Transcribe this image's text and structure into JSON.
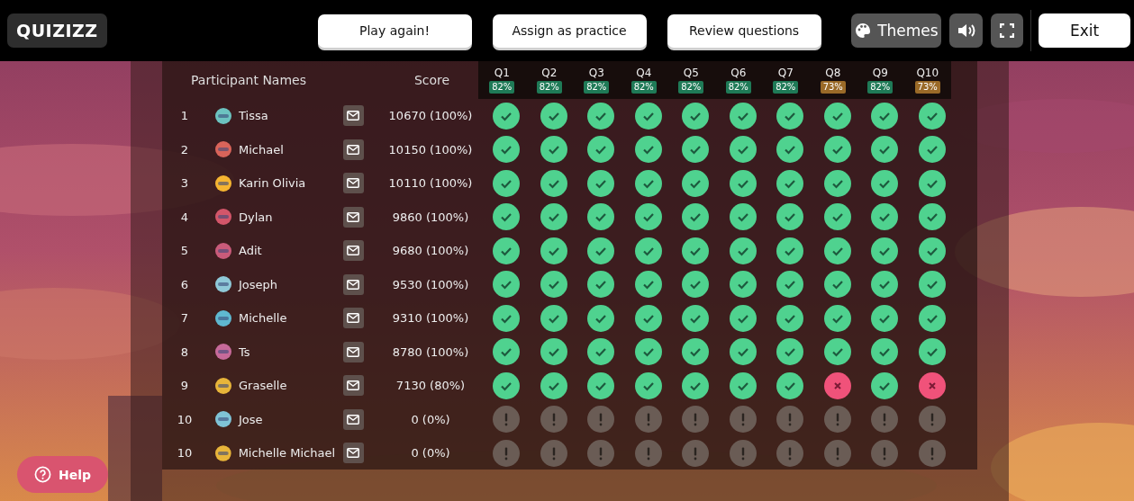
{
  "logo": "QUIZIZZ",
  "toolbar": {
    "buttons": [
      "Play again!",
      "Assign as practice",
      "Review questions"
    ],
    "themes": "Themes",
    "exit": "Exit"
  },
  "table": {
    "name_heading": "Participant Names",
    "score_heading": "Score",
    "questions": [
      {
        "label": "Q1",
        "accuracy": "82%",
        "color": "#1f7a57"
      },
      {
        "label": "Q2",
        "accuracy": "82%",
        "color": "#1f7a57"
      },
      {
        "label": "Q3",
        "accuracy": "82%",
        "color": "#1f7a57"
      },
      {
        "label": "Q4",
        "accuracy": "82%",
        "color": "#1f7a57"
      },
      {
        "label": "Q5",
        "accuracy": "82%",
        "color": "#1f7a57"
      },
      {
        "label": "Q6",
        "accuracy": "82%",
        "color": "#1f7a57"
      },
      {
        "label": "Q7",
        "accuracy": "82%",
        "color": "#1f7a57"
      },
      {
        "label": "Q8",
        "accuracy": "73%",
        "color": "#9a6a28"
      },
      {
        "label": "Q9",
        "accuracy": "82%",
        "color": "#1f7a57"
      },
      {
        "label": "Q10",
        "accuracy": "73%",
        "color": "#9a6a28"
      }
    ],
    "rows": [
      {
        "rank": "1",
        "name": "Tissa",
        "color": "#6cc3c0",
        "score": "10670 (100%)",
        "answers": [
          {
            "kind": "correct"
          },
          {
            "kind": "correct"
          },
          {
            "kind": "correct"
          },
          {
            "kind": "correct"
          },
          {
            "kind": "correct"
          },
          {
            "kind": "correct"
          },
          {
            "kind": "correct"
          },
          {
            "kind": "correct"
          },
          {
            "kind": "correct"
          },
          {
            "kind": "correct"
          }
        ]
      },
      {
        "rank": "2",
        "name": "Michael",
        "color": "#d9645a",
        "score": "10150 (100%)",
        "answers": [
          {
            "kind": "correct"
          },
          {
            "kind": "correct"
          },
          {
            "kind": "correct"
          },
          {
            "kind": "correct"
          },
          {
            "kind": "correct"
          },
          {
            "kind": "correct"
          },
          {
            "kind": "correct"
          },
          {
            "kind": "correct"
          },
          {
            "kind": "correct"
          },
          {
            "kind": "correct"
          }
        ]
      },
      {
        "rank": "3",
        "name": "Karin Olivia",
        "color": "#f5b531",
        "score": "10110 (100%)",
        "answers": [
          {
            "kind": "correct"
          },
          {
            "kind": "correct"
          },
          {
            "kind": "correct"
          },
          {
            "kind": "correct"
          },
          {
            "kind": "correct"
          },
          {
            "kind": "correct"
          },
          {
            "kind": "correct"
          },
          {
            "kind": "correct"
          },
          {
            "kind": "correct"
          },
          {
            "kind": "correct"
          }
        ]
      },
      {
        "rank": "4",
        "name": "Dylan",
        "color": "#d4566a",
        "score": "9860 (100%)",
        "answers": [
          {
            "kind": "correct"
          },
          {
            "kind": "correct"
          },
          {
            "kind": "correct"
          },
          {
            "kind": "correct"
          },
          {
            "kind": "correct"
          },
          {
            "kind": "correct"
          },
          {
            "kind": "correct"
          },
          {
            "kind": "correct"
          },
          {
            "kind": "correct"
          },
          {
            "kind": "correct"
          }
        ]
      },
      {
        "rank": "5",
        "name": "Adit",
        "color": "#c95b7a",
        "score": "9680 (100%)",
        "answers": [
          {
            "kind": "correct"
          },
          {
            "kind": "correct"
          },
          {
            "kind": "correct"
          },
          {
            "kind": "correct"
          },
          {
            "kind": "correct"
          },
          {
            "kind": "correct"
          },
          {
            "kind": "correct"
          },
          {
            "kind": "correct"
          },
          {
            "kind": "correct"
          },
          {
            "kind": "correct"
          }
        ]
      },
      {
        "rank": "6",
        "name": "Joseph",
        "color": "#8fc9d8",
        "score": "9530 (100%)",
        "answers": [
          {
            "kind": "correct"
          },
          {
            "kind": "correct"
          },
          {
            "kind": "correct"
          },
          {
            "kind": "correct"
          },
          {
            "kind": "correct"
          },
          {
            "kind": "correct"
          },
          {
            "kind": "correct"
          },
          {
            "kind": "correct"
          },
          {
            "kind": "correct"
          },
          {
            "kind": "correct"
          }
        ]
      },
      {
        "rank": "7",
        "name": "Michelle",
        "color": "#5fb8d0",
        "score": "9310 (100%)",
        "answers": [
          {
            "kind": "correct"
          },
          {
            "kind": "correct"
          },
          {
            "kind": "correct"
          },
          {
            "kind": "correct"
          },
          {
            "kind": "correct"
          },
          {
            "kind": "correct"
          },
          {
            "kind": "correct"
          },
          {
            "kind": "correct"
          },
          {
            "kind": "correct"
          },
          {
            "kind": "correct"
          }
        ]
      },
      {
        "rank": "8",
        "name": "Ts",
        "color": "#c76a9a",
        "score": "8780 (100%)",
        "answers": [
          {
            "kind": "correct"
          },
          {
            "kind": "correct"
          },
          {
            "kind": "correct"
          },
          {
            "kind": "correct"
          },
          {
            "kind": "correct"
          },
          {
            "kind": "correct"
          },
          {
            "kind": "correct"
          },
          {
            "kind": "correct"
          },
          {
            "kind": "correct"
          },
          {
            "kind": "correct"
          }
        ]
      },
      {
        "rank": "9",
        "name": "Graselle",
        "color": "#e8b53a",
        "score": "7130 (80%)",
        "answers": [
          {
            "kind": "correct"
          },
          {
            "kind": "correct"
          },
          {
            "kind": "correct"
          },
          {
            "kind": "correct"
          },
          {
            "kind": "correct"
          },
          {
            "kind": "correct"
          },
          {
            "kind": "correct"
          },
          {
            "kind": "incorrect"
          },
          {
            "kind": "correct"
          },
          {
            "kind": "incorrect"
          }
        ]
      },
      {
        "rank": "10",
        "name": "Jose",
        "color": "#7fc3d6",
        "score": "0 (0%)",
        "answers": [
          {
            "kind": "unattempted"
          },
          {
            "kind": "unattempted"
          },
          {
            "kind": "unattempted"
          },
          {
            "kind": "unattempted"
          },
          {
            "kind": "unattempted"
          },
          {
            "kind": "unattempted"
          },
          {
            "kind": "unattempted"
          },
          {
            "kind": "unattempted"
          },
          {
            "kind": "unattempted"
          },
          {
            "kind": "unattempted"
          }
        ]
      },
      {
        "rank": "10",
        "name": "Michelle Michael",
        "color": "#e8b53a",
        "score": "0 (0%)",
        "answers": [
          {
            "kind": "unattempted"
          },
          {
            "kind": "unattempted"
          },
          {
            "kind": "unattempted"
          },
          {
            "kind": "unattempted"
          },
          {
            "kind": "unattempted"
          },
          {
            "kind": "unattempted"
          },
          {
            "kind": "unattempted"
          },
          {
            "kind": "unattempted"
          },
          {
            "kind": "unattempted"
          },
          {
            "kind": "unattempted"
          }
        ]
      }
    ]
  },
  "help": "Help"
}
